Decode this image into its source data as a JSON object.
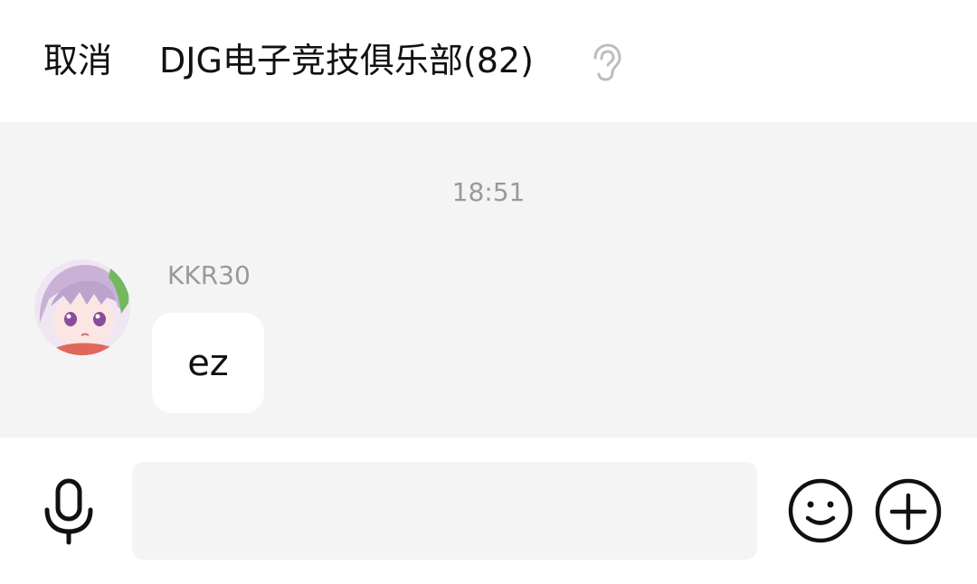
{
  "header": {
    "cancel_label": "取消",
    "title": "DJG电子竞技俱乐部(82)",
    "ear_icon": "ear-icon"
  },
  "chat": {
    "timestamp": "18:51",
    "messages": [
      {
        "sender": "KKR30",
        "text": "ez",
        "avatar_icon": "anime-avatar"
      }
    ]
  },
  "input_bar": {
    "mic_icon": "microphone-icon",
    "input_value": "",
    "emoji_icon": "smiley-icon",
    "plus_icon": "plus-circle-icon"
  },
  "colors": {
    "chat_background": "#f5f4f5",
    "bubble_background": "#ffffff",
    "muted_text": "#999999"
  }
}
